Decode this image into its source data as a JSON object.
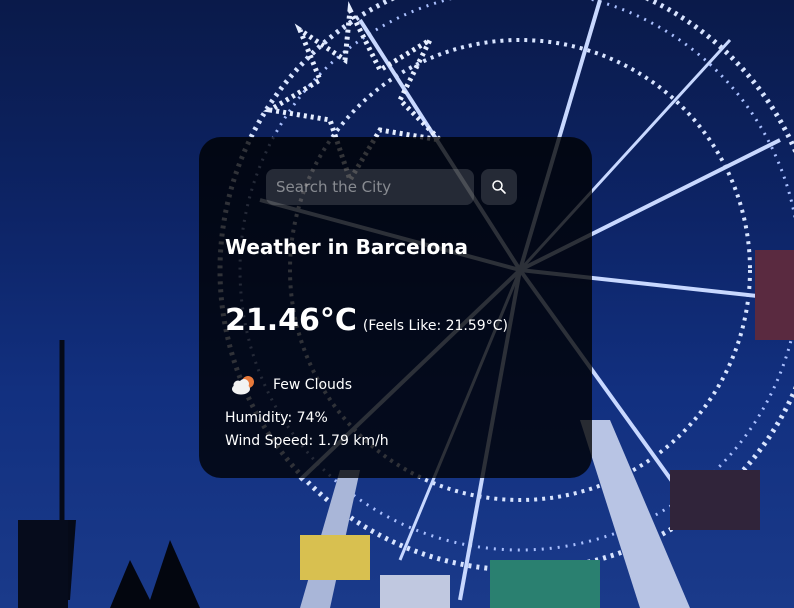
{
  "search": {
    "placeholder": "Search the City"
  },
  "weather": {
    "title": "Weather in Barcelona",
    "temperature": "21.46°C",
    "feels_like": "(Feels Like: 21.59°C)",
    "condition": "Few Clouds",
    "condition_icon": "few-clouds-icon",
    "humidity": "Humidity: 74%",
    "wind_speed": "Wind Speed: 1.79 km/h"
  },
  "colors": {
    "card_background": "#000000",
    "text": "#ffffff",
    "sky": "#0d2466",
    "lights": "#c8d8ff"
  }
}
